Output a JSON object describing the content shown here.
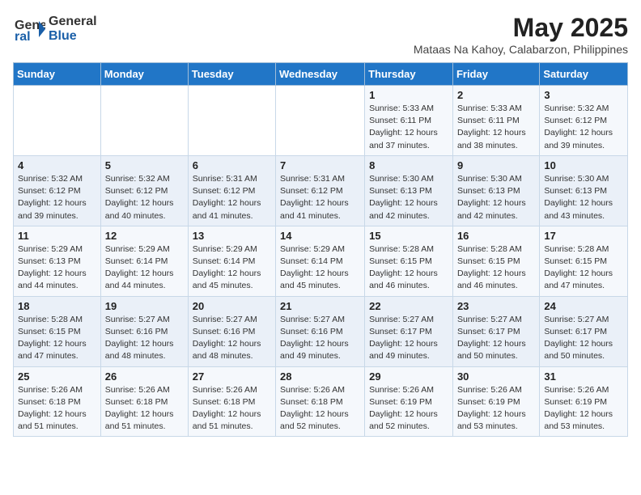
{
  "logo": {
    "general": "General",
    "blue": "Blue"
  },
  "title": {
    "month_year": "May 2025",
    "location": "Mataas Na Kahoy, Calabarzon, Philippines"
  },
  "header_days": [
    "Sunday",
    "Monday",
    "Tuesday",
    "Wednesday",
    "Thursday",
    "Friday",
    "Saturday"
  ],
  "weeks": [
    [
      {
        "day": "",
        "info": ""
      },
      {
        "day": "",
        "info": ""
      },
      {
        "day": "",
        "info": ""
      },
      {
        "day": "",
        "info": ""
      },
      {
        "day": "1",
        "info": "Sunrise: 5:33 AM\nSunset: 6:11 PM\nDaylight: 12 hours and 37 minutes."
      },
      {
        "day": "2",
        "info": "Sunrise: 5:33 AM\nSunset: 6:11 PM\nDaylight: 12 hours and 38 minutes."
      },
      {
        "day": "3",
        "info": "Sunrise: 5:32 AM\nSunset: 6:12 PM\nDaylight: 12 hours and 39 minutes."
      }
    ],
    [
      {
        "day": "4",
        "info": "Sunrise: 5:32 AM\nSunset: 6:12 PM\nDaylight: 12 hours and 39 minutes."
      },
      {
        "day": "5",
        "info": "Sunrise: 5:32 AM\nSunset: 6:12 PM\nDaylight: 12 hours and 40 minutes."
      },
      {
        "day": "6",
        "info": "Sunrise: 5:31 AM\nSunset: 6:12 PM\nDaylight: 12 hours and 41 minutes."
      },
      {
        "day": "7",
        "info": "Sunrise: 5:31 AM\nSunset: 6:12 PM\nDaylight: 12 hours and 41 minutes."
      },
      {
        "day": "8",
        "info": "Sunrise: 5:30 AM\nSunset: 6:13 PM\nDaylight: 12 hours and 42 minutes."
      },
      {
        "day": "9",
        "info": "Sunrise: 5:30 AM\nSunset: 6:13 PM\nDaylight: 12 hours and 42 minutes."
      },
      {
        "day": "10",
        "info": "Sunrise: 5:30 AM\nSunset: 6:13 PM\nDaylight: 12 hours and 43 minutes."
      }
    ],
    [
      {
        "day": "11",
        "info": "Sunrise: 5:29 AM\nSunset: 6:13 PM\nDaylight: 12 hours and 44 minutes."
      },
      {
        "day": "12",
        "info": "Sunrise: 5:29 AM\nSunset: 6:14 PM\nDaylight: 12 hours and 44 minutes."
      },
      {
        "day": "13",
        "info": "Sunrise: 5:29 AM\nSunset: 6:14 PM\nDaylight: 12 hours and 45 minutes."
      },
      {
        "day": "14",
        "info": "Sunrise: 5:29 AM\nSunset: 6:14 PM\nDaylight: 12 hours and 45 minutes."
      },
      {
        "day": "15",
        "info": "Sunrise: 5:28 AM\nSunset: 6:15 PM\nDaylight: 12 hours and 46 minutes."
      },
      {
        "day": "16",
        "info": "Sunrise: 5:28 AM\nSunset: 6:15 PM\nDaylight: 12 hours and 46 minutes."
      },
      {
        "day": "17",
        "info": "Sunrise: 5:28 AM\nSunset: 6:15 PM\nDaylight: 12 hours and 47 minutes."
      }
    ],
    [
      {
        "day": "18",
        "info": "Sunrise: 5:28 AM\nSunset: 6:15 PM\nDaylight: 12 hours and 47 minutes."
      },
      {
        "day": "19",
        "info": "Sunrise: 5:27 AM\nSunset: 6:16 PM\nDaylight: 12 hours and 48 minutes."
      },
      {
        "day": "20",
        "info": "Sunrise: 5:27 AM\nSunset: 6:16 PM\nDaylight: 12 hours and 48 minutes."
      },
      {
        "day": "21",
        "info": "Sunrise: 5:27 AM\nSunset: 6:16 PM\nDaylight: 12 hours and 49 minutes."
      },
      {
        "day": "22",
        "info": "Sunrise: 5:27 AM\nSunset: 6:17 PM\nDaylight: 12 hours and 49 minutes."
      },
      {
        "day": "23",
        "info": "Sunrise: 5:27 AM\nSunset: 6:17 PM\nDaylight: 12 hours and 50 minutes."
      },
      {
        "day": "24",
        "info": "Sunrise: 5:27 AM\nSunset: 6:17 PM\nDaylight: 12 hours and 50 minutes."
      }
    ],
    [
      {
        "day": "25",
        "info": "Sunrise: 5:26 AM\nSunset: 6:18 PM\nDaylight: 12 hours and 51 minutes."
      },
      {
        "day": "26",
        "info": "Sunrise: 5:26 AM\nSunset: 6:18 PM\nDaylight: 12 hours and 51 minutes."
      },
      {
        "day": "27",
        "info": "Sunrise: 5:26 AM\nSunset: 6:18 PM\nDaylight: 12 hours and 51 minutes."
      },
      {
        "day": "28",
        "info": "Sunrise: 5:26 AM\nSunset: 6:18 PM\nDaylight: 12 hours and 52 minutes."
      },
      {
        "day": "29",
        "info": "Sunrise: 5:26 AM\nSunset: 6:19 PM\nDaylight: 12 hours and 52 minutes."
      },
      {
        "day": "30",
        "info": "Sunrise: 5:26 AM\nSunset: 6:19 PM\nDaylight: 12 hours and 53 minutes."
      },
      {
        "day": "31",
        "info": "Sunrise: 5:26 AM\nSunset: 6:19 PM\nDaylight: 12 hours and 53 minutes."
      }
    ]
  ]
}
